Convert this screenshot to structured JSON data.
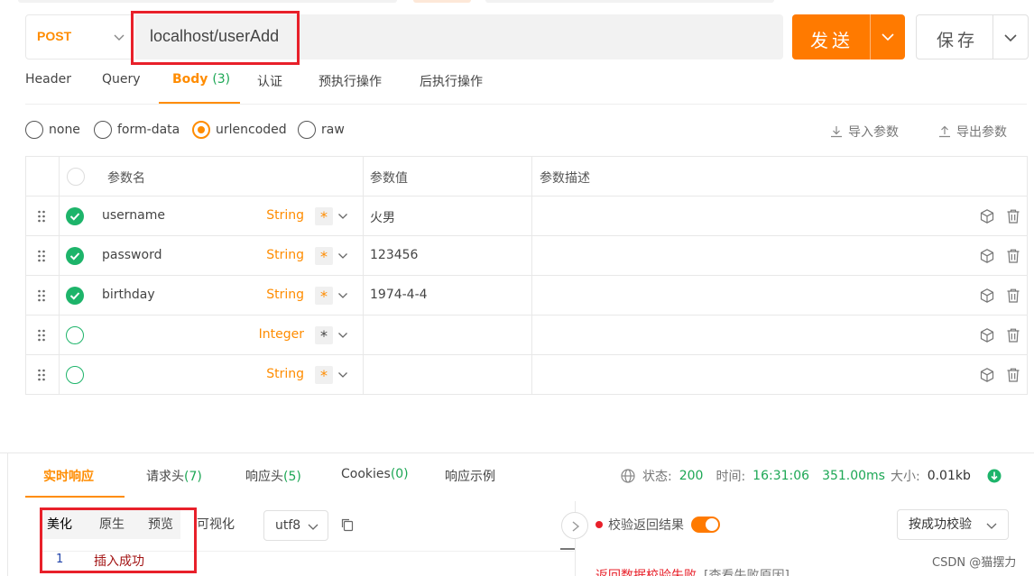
{
  "request": {
    "method": "POST",
    "url": "localhost/userAdd",
    "send_label": "发送",
    "save_label": "保存"
  },
  "tabs": [
    {
      "label": "Header"
    },
    {
      "label": "Query"
    },
    {
      "label": "Body",
      "count": "(3)",
      "active": true
    },
    {
      "label": "认证"
    },
    {
      "label": "预执行操作"
    },
    {
      "label": "后执行操作"
    }
  ],
  "body_types": [
    {
      "label": "none",
      "selected": false
    },
    {
      "label": "form-data",
      "selected": false
    },
    {
      "label": "urlencoded",
      "selected": true
    },
    {
      "label": "raw",
      "selected": false
    }
  ],
  "import_label": "导入参数",
  "export_label": "导出参数",
  "table": {
    "headers": {
      "name": "参数名",
      "value": "参数值",
      "desc": "参数描述"
    },
    "rows": [
      {
        "checked": true,
        "name": "username",
        "type": "String",
        "required": "*",
        "value": "火男"
      },
      {
        "checked": true,
        "name": "password",
        "type": "String",
        "required": "*",
        "value": "123456"
      },
      {
        "checked": true,
        "name": "birthday",
        "type": "String",
        "required": "*",
        "value": "1974-4-4"
      },
      {
        "checked": false,
        "name": "",
        "type": "Integer",
        "required": "*",
        "value": ""
      },
      {
        "checked": false,
        "name": "",
        "type": "String",
        "required": "*",
        "value": ""
      }
    ]
  },
  "response": {
    "tabs": [
      {
        "label": "实时响应",
        "active": true
      },
      {
        "label": "请求头",
        "count": "(7)"
      },
      {
        "label": "响应头",
        "count": "(5)"
      },
      {
        "label": "Cookies",
        "count": "(0)"
      },
      {
        "label": "响应示例"
      }
    ],
    "status_label": "状态:",
    "status_value": "200",
    "time_label": "时间:",
    "time_value": "16:31:06",
    "duration": "351.00ms",
    "size_label": "大小:",
    "size_value": "0.01kb",
    "format_tabs": [
      "美化",
      "原生",
      "预览",
      "可视化"
    ],
    "encoding": "utf8",
    "lines": [
      {
        "num": "1",
        "text": "插入成功"
      }
    ],
    "verify_label": "校验返回结果",
    "verify_on": true,
    "verify_mode": "按成功校验",
    "error_text": "返回数据校验失败",
    "error_link": "[查看失败原因]"
  },
  "watermark": "CSDN @猫摆力",
  "colors": {
    "accent": "#ff7a00",
    "success": "#1db46a",
    "highlight_box": "#e8202a"
  }
}
